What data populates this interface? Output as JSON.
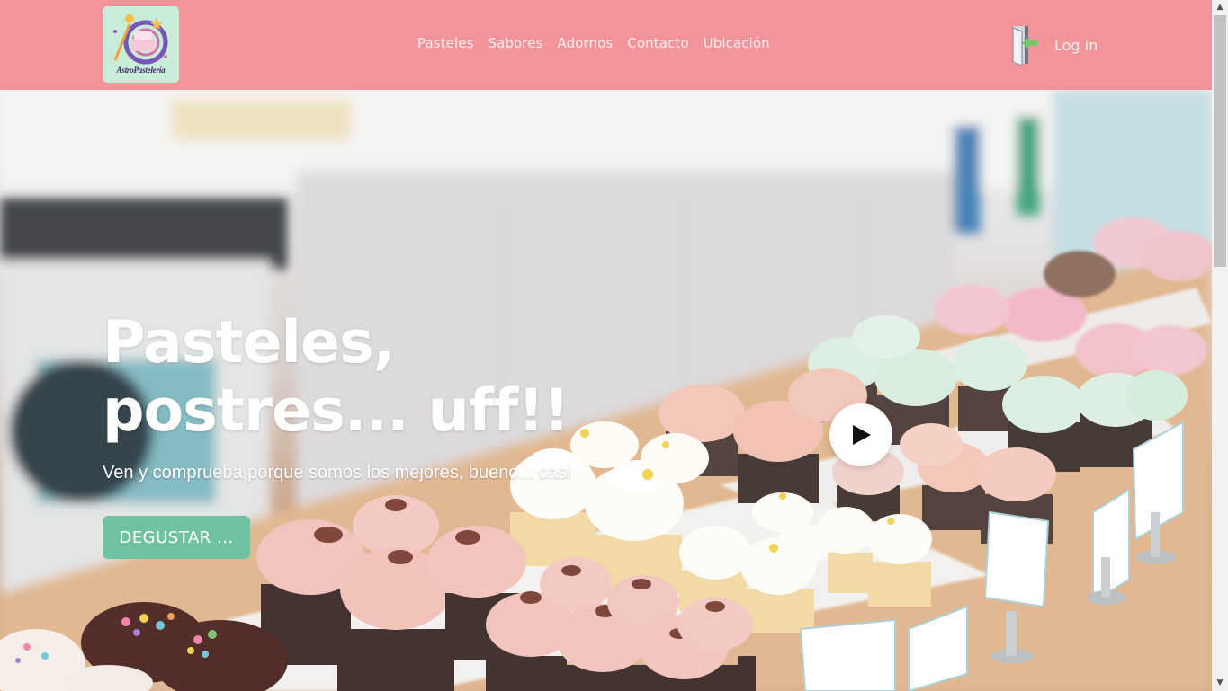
{
  "brand": {
    "logo_text": "AstroPastelería"
  },
  "nav": {
    "items": [
      {
        "label": "Pasteles"
      },
      {
        "label": "Sabores"
      },
      {
        "label": "Adornos"
      },
      {
        "label": "Contacto"
      },
      {
        "label": "Ubicación"
      }
    ],
    "login_label": "Log in",
    "login_icon": "door-enter-icon"
  },
  "hero": {
    "title_line1": "Pasteles,",
    "title_line2": "postres... uff!!",
    "subtitle": "Ven y comprueba porque somos los mejores, bueno... casi",
    "cta_label": "DEGUSTAR ...",
    "play_icon": "play-icon",
    "background": "cupcakes-display-photo"
  },
  "colors": {
    "navbar": "#f29499",
    "cta": "#6fc3a3",
    "logo_bg": "#c9ecd8"
  }
}
